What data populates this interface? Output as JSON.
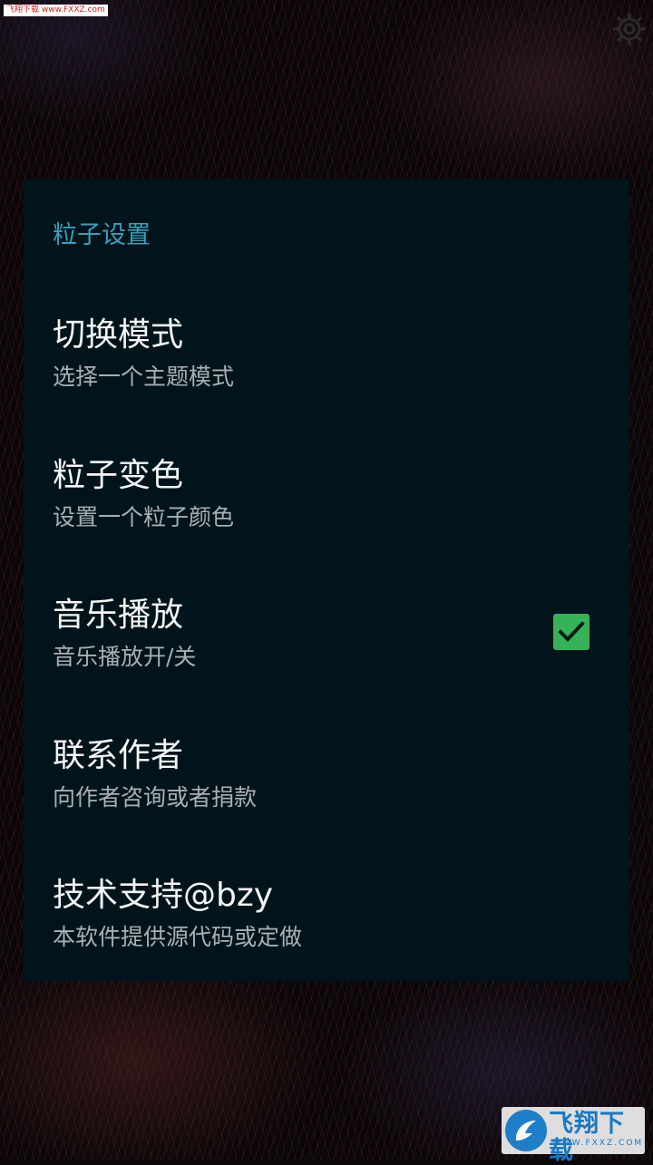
{
  "watermark_top": "飞翔下载 www.FXXZ.com",
  "settings": {
    "section_title": "粒子设置",
    "items": [
      {
        "title": "切换模式",
        "summary": "选择一个主题模式"
      },
      {
        "title": "粒子变色",
        "summary": "设置一个粒子颜色"
      },
      {
        "title": "音乐播放",
        "summary": "音乐播放开/关",
        "checked": true
      },
      {
        "title": "联系作者",
        "summary": "向作者咨询或者捐款"
      },
      {
        "title": "技术支持@bzy",
        "summary": "本软件提供源代码或定做"
      }
    ]
  },
  "logo": {
    "name": "飞翔下载",
    "url": "WWW.FXXZ.COM"
  },
  "colors": {
    "accent": "#3a9fbd",
    "checkbox": "#36b35a",
    "dialog_bg": "#01141b"
  },
  "icons": {
    "settings": "gear-icon",
    "checkbox": "check-icon",
    "logo": "fxxz-logo-icon"
  }
}
